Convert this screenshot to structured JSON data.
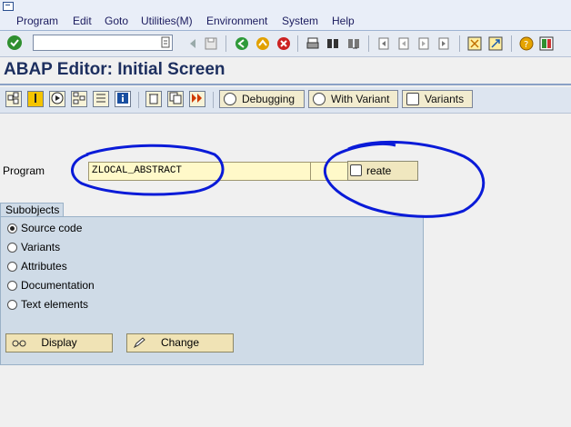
{
  "menu": {
    "items": [
      "Program",
      "Edit",
      "Goto",
      "Utilities(M)",
      "Environment",
      "System",
      "Help"
    ]
  },
  "standard_toolbar": {
    "command_field": {
      "value": "",
      "placeholder": ""
    },
    "icons": [
      "enter-icon",
      "save-icon",
      "back-icon",
      "exit-icon",
      "cancel-icon",
      "print-icon",
      "find-icon",
      "find-next-icon",
      "first-page-icon",
      "previous-page-icon",
      "next-page-icon",
      "last-page-icon",
      "new-session-icon",
      "shortcut-icon",
      "help-icon",
      "layout-menu-icon"
    ]
  },
  "page": {
    "title": "ABAP Editor: Initial Screen"
  },
  "app_toolbar": {
    "buttons": [
      {
        "label": "Debugging"
      },
      {
        "label": "With Variant"
      },
      {
        "label": "Variants"
      }
    ]
  },
  "program": {
    "label": "Program",
    "value": "ZLOCAL_ABSTRACT",
    "create_label": "reate"
  },
  "subobjects": {
    "title": "Subobjects",
    "options": [
      {
        "label": "Source code",
        "checked": true
      },
      {
        "label": "Variants",
        "checked": false
      },
      {
        "label": "Attributes",
        "checked": false
      },
      {
        "label": "Documentation",
        "checked": false
      },
      {
        "label": "Text elements",
        "checked": false
      }
    ],
    "display_label": "Display",
    "change_label": "Change"
  },
  "colors": {
    "input_bg": "#fff9c9",
    "annotation_stroke": "#0a1bd8",
    "title_text": "#1d2f5f"
  }
}
